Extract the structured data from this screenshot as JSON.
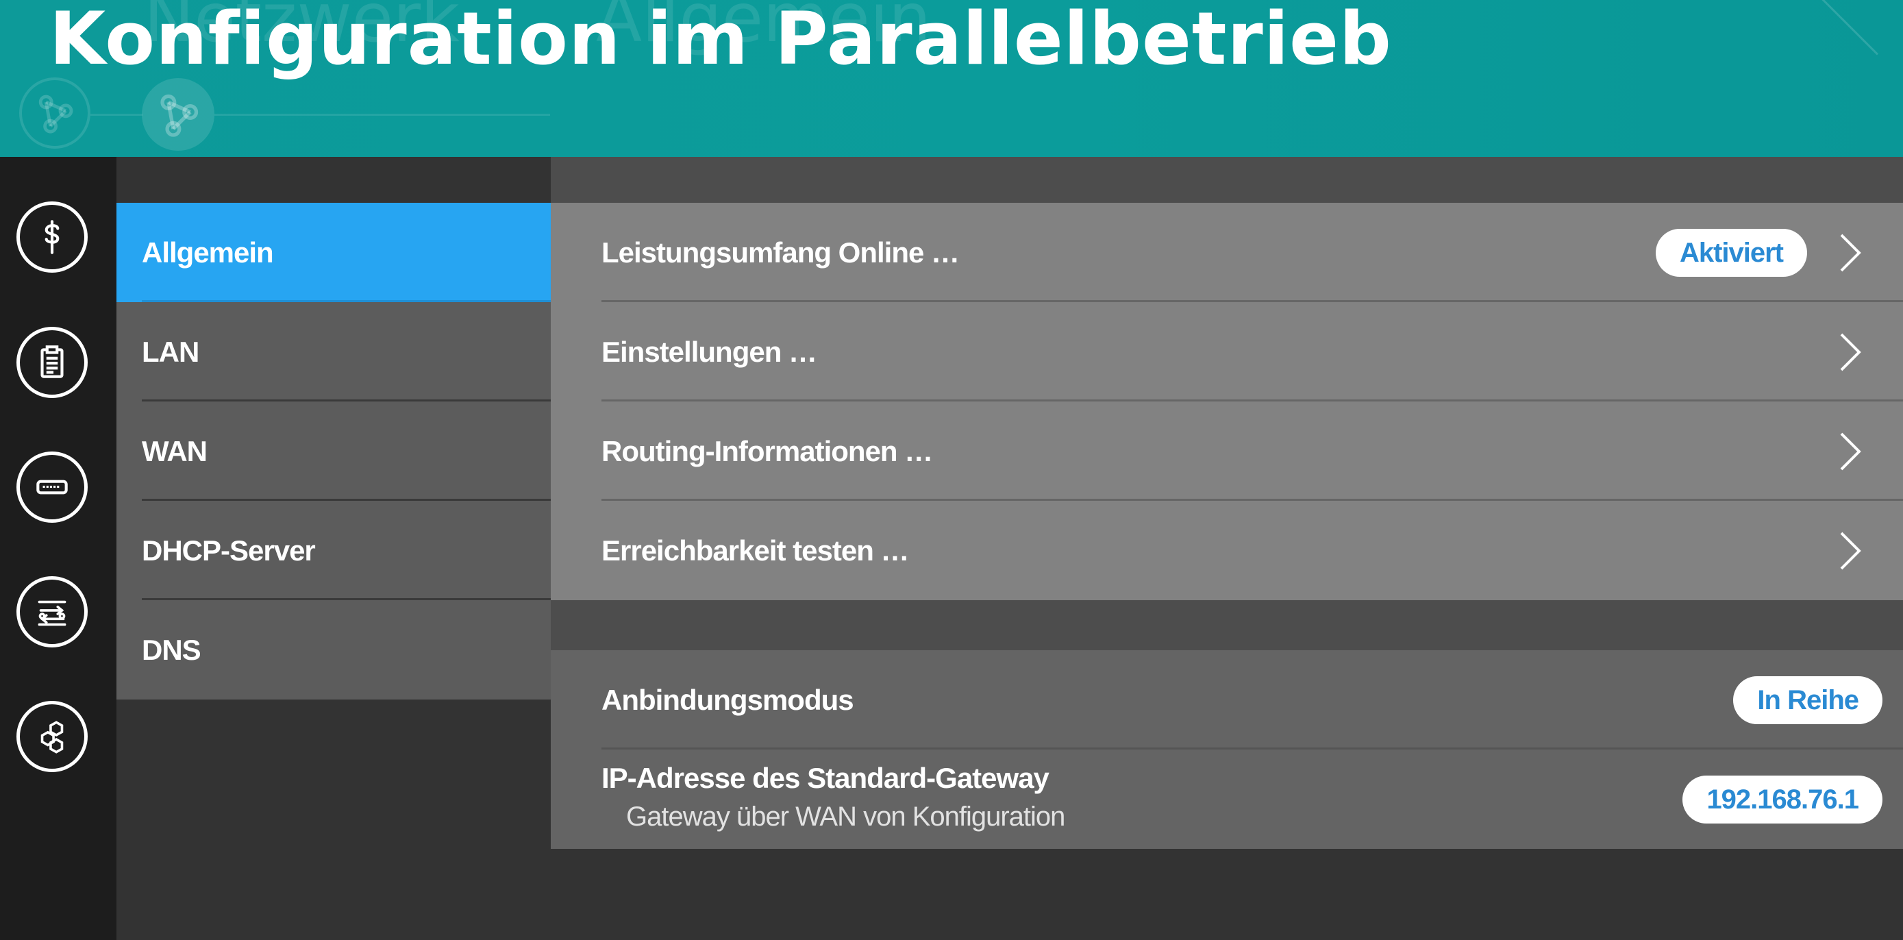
{
  "slide": {
    "title": "Konfiguration im Parallelbetrieb",
    "ghost_breadcrumb": [
      "Netzwerk",
      "Allgemein"
    ]
  },
  "rail": {
    "items": [
      {
        "icon": "medical-icon"
      },
      {
        "icon": "clipboard-icon"
      },
      {
        "icon": "router-icon"
      },
      {
        "icon": "transfer-icon"
      },
      {
        "icon": "network-hexagon-icon"
      }
    ]
  },
  "nav": {
    "items": [
      {
        "label": "Allgemein",
        "active": true
      },
      {
        "label": "LAN",
        "active": false
      },
      {
        "label": "WAN",
        "active": false
      },
      {
        "label": "DHCP-Server",
        "active": false
      },
      {
        "label": "DNS",
        "active": false
      }
    ]
  },
  "menu": {
    "rows": [
      {
        "label": "Leistungsumfang Online …",
        "badge": "Aktiviert"
      },
      {
        "label": "Einstellungen …"
      },
      {
        "label": "Routing-Informationen …"
      },
      {
        "label": "Erreichbarkeit testen …"
      }
    ]
  },
  "info": {
    "mode_label": "Anbindungsmodus",
    "mode_value": "In Reihe",
    "gateway_label": "IP-Adresse des Standard-Gateway",
    "gateway_sub": "Gateway über WAN von Konfiguration",
    "gateway_value": "192.168.76.1"
  },
  "colors": {
    "banner": "#0b9c9b",
    "active_nav": "#27a5f2",
    "pill_text": "#2a8ad3",
    "menu_bg": "#828282",
    "info_bg": "#646464"
  }
}
